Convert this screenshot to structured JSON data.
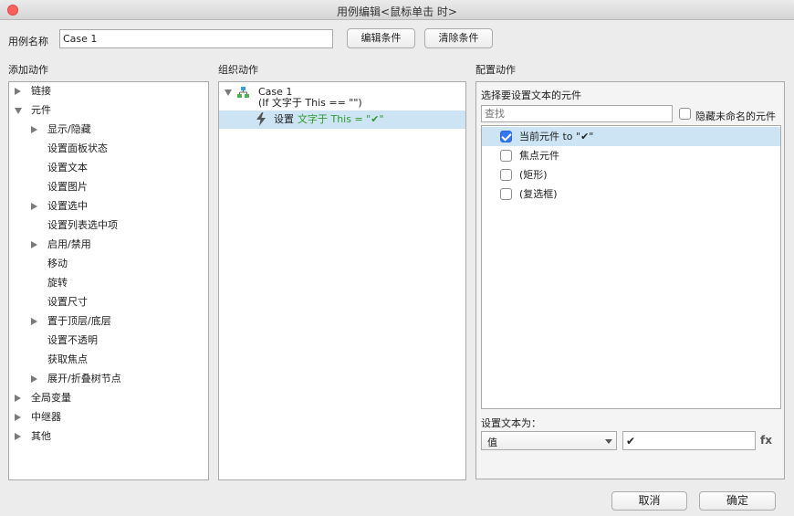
{
  "window": {
    "title": "用例编辑<鼠标单击 时>"
  },
  "case_name": {
    "label": "用例名称",
    "value": "Case 1",
    "edit_button": "编辑条件",
    "clear_button": "清除条件"
  },
  "add_actions": {
    "header": "添加动作",
    "items": [
      {
        "label": "链接",
        "level": 0,
        "expander": "collapsed"
      },
      {
        "label": "元件",
        "level": 0,
        "expander": "expanded"
      },
      {
        "label": "显示/隐藏",
        "level": 1,
        "expander": "collapsed"
      },
      {
        "label": "设置面板状态",
        "level": 1,
        "expander": "none"
      },
      {
        "label": "设置文本",
        "level": 1,
        "expander": "none"
      },
      {
        "label": "设置图片",
        "level": 1,
        "expander": "none"
      },
      {
        "label": "设置选中",
        "level": 1,
        "expander": "collapsed"
      },
      {
        "label": "设置列表选中项",
        "level": 1,
        "expander": "none"
      },
      {
        "label": "启用/禁用",
        "level": 1,
        "expander": "collapsed"
      },
      {
        "label": "移动",
        "level": 1,
        "expander": "none"
      },
      {
        "label": "旋转",
        "level": 1,
        "expander": "none"
      },
      {
        "label": "设置尺寸",
        "level": 1,
        "expander": "none"
      },
      {
        "label": "置于顶层/底层",
        "level": 1,
        "expander": "collapsed"
      },
      {
        "label": "设置不透明",
        "level": 1,
        "expander": "none"
      },
      {
        "label": "获取焦点",
        "level": 1,
        "expander": "none"
      },
      {
        "label": "展开/折叠树节点",
        "level": 1,
        "expander": "collapsed"
      },
      {
        "label": "全局变量",
        "level": 0,
        "expander": "collapsed"
      },
      {
        "label": "中继器",
        "level": 0,
        "expander": "collapsed"
      },
      {
        "label": "其他",
        "level": 0,
        "expander": "collapsed"
      }
    ]
  },
  "organize_actions": {
    "header": "组织动作",
    "case_title": "Case 1",
    "case_condition": "(If 文字于 This == \"\")",
    "action_prefix": "设置",
    "action_target": "文字于 This = \"✔\""
  },
  "configure_actions": {
    "header": "配置动作",
    "select_label": "选择要设置文本的元件",
    "search_placeholder": "查找",
    "hide_unnamed_label": "隐藏未命名的元件",
    "widgets": [
      {
        "label": "当前元件 to \"✔\"",
        "checked": true,
        "selected": true
      },
      {
        "label": "焦点元件",
        "checked": false,
        "selected": false
      },
      {
        "label": "(矩形)",
        "checked": false,
        "selected": false
      },
      {
        "label": "(复选框)",
        "checked": false,
        "selected": false
      }
    ],
    "set_text_label": "设置文本为：",
    "value_type": "值",
    "value_text": "✔",
    "fx_label": "fx"
  },
  "footer": {
    "cancel": "取消",
    "ok": "确定"
  },
  "colors": {
    "selection": "#cce4f3",
    "accent": "#3478f6",
    "green_text": "#2f9a2f",
    "close": "#fc605c"
  }
}
